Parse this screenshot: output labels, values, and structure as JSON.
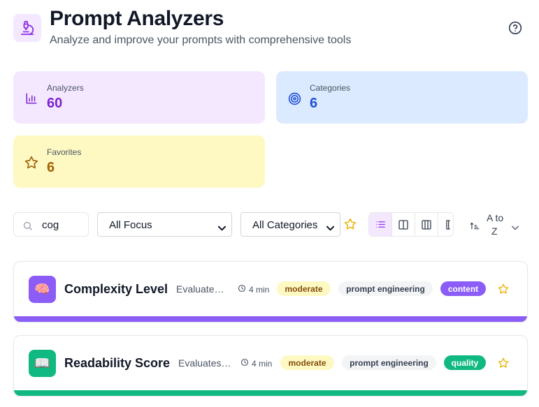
{
  "header": {
    "title": "Prompt Analyzers",
    "subtitle": "Analyze and improve your prompts with comprehensive tools",
    "logo_icon": "microscope-icon",
    "help_icon": "help-circle-icon"
  },
  "stats": {
    "analyzers": {
      "label": "Analyzers",
      "value": "60",
      "color": "#7e22ce",
      "icon": "bar-chart-icon"
    },
    "categories": {
      "label": "Categories",
      "value": "6",
      "color": "#1d4ed8",
      "icon": "target-icon"
    },
    "favorites": {
      "label": "Favorites",
      "value": "6",
      "color": "#a16207",
      "icon": "star-icon"
    }
  },
  "filters": {
    "search_value": "cog",
    "focus_selected": "All Focus",
    "category_selected": "All Categories",
    "sort_line1": "A to",
    "sort_line2": "Z"
  },
  "analyzers": [
    {
      "emoji": "🧠",
      "name": "Complexity Level",
      "description": "Evaluate…",
      "time": "4 min",
      "complexity": "moderate",
      "tag": "prompt engineering",
      "category": "content",
      "accent": "#8b5cf6"
    },
    {
      "emoji": "📖",
      "name": "Readability Score",
      "description": "Evaluates…",
      "time": "4 min",
      "complexity": "moderate",
      "tag": "prompt engineering",
      "category": "quality",
      "accent": "#10b981"
    }
  ]
}
